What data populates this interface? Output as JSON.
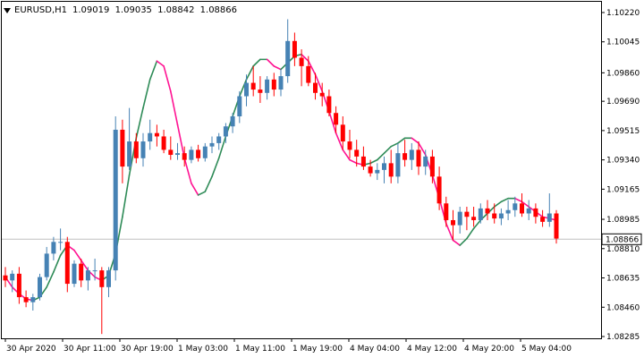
{
  "header": {
    "symbol_timeframe": "EURUSD,H1",
    "open": "1.09019",
    "high": "1.09035",
    "low": "1.08842",
    "close": "1.08866"
  },
  "current_price": "1.08866",
  "colors": {
    "bull_candle": "#4682b4",
    "bear_candle": "#ff0000",
    "ma_up": "#2e8b57",
    "ma_down": "#ff1493",
    "price_line": "#c0c0c0"
  },
  "chart_data": {
    "type": "candlestick",
    "price_axis_labels": [
      "1.10220",
      "1.10045",
      "1.09860",
      "1.09690",
      "1.09515",
      "1.09340",
      "1.09165",
      "1.08985",
      "1.08810",
      "1.08635",
      "1.08460",
      "1.08285"
    ],
    "time_axis_labels": [
      "30 Apr 2020",
      "30 Apr 11:00",
      "30 Apr 19:00",
      "1 May 03:00",
      "1 May 11:00",
      "1 May 19:00",
      "4 May 04:00",
      "4 May 12:00",
      "4 May 20:00",
      "5 May 04:00"
    ],
    "ylim": [
      1.08285,
      1.1022
    ],
    "candles": [
      [
        1.0865,
        1.087,
        1.0858,
        1.0862
      ],
      [
        1.0862,
        1.0868,
        1.0855,
        1.0866
      ],
      [
        1.0866,
        1.087,
        1.0848,
        1.0852
      ],
      [
        1.0852,
        1.0856,
        1.0846,
        1.0849
      ],
      [
        1.0849,
        1.0854,
        1.0844,
        1.0852
      ],
      [
        1.0852,
        1.0866,
        1.085,
        1.0864
      ],
      [
        1.0864,
        1.0882,
        1.0862,
        1.0878
      ],
      [
        1.0878,
        1.0888,
        1.0874,
        1.0885
      ],
      [
        1.0885,
        1.0893,
        1.088,
        1.0885
      ],
      [
        1.0885,
        1.0888,
        1.0855,
        1.086
      ],
      [
        1.086,
        1.0874,
        1.0858,
        1.0872
      ],
      [
        1.0872,
        1.0875,
        1.0858,
        1.0862
      ],
      [
        1.0862,
        1.087,
        1.0856,
        1.0868
      ],
      [
        1.0868,
        1.0875,
        1.0862,
        1.0868
      ],
      [
        1.0868,
        1.087,
        1.083,
        1.0858
      ],
      [
        1.0858,
        1.087,
        1.0852,
        1.0868
      ],
      [
        1.0868,
        1.096,
        1.0862,
        1.0952
      ],
      [
        1.0952,
        1.0958,
        1.092,
        1.093
      ],
      [
        1.093,
        1.0965,
        1.0928,
        1.0945
      ],
      [
        1.0945,
        1.095,
        1.0932,
        1.0935
      ],
      [
        1.0935,
        1.095,
        1.093,
        1.0945
      ],
      [
        1.0945,
        1.0958,
        1.094,
        1.095
      ],
      [
        1.095,
        1.0955,
        1.0942,
        1.0948
      ],
      [
        1.0948,
        1.0952,
        1.0938,
        1.094
      ],
      [
        1.094,
        1.0948,
        1.0934,
        1.0937
      ],
      [
        1.0937,
        1.0944,
        1.0934,
        1.0938
      ],
      [
        1.0938,
        1.0942,
        1.093,
        1.0934
      ],
      [
        1.0934,
        1.0942,
        1.0932,
        1.094
      ],
      [
        1.094,
        1.0943,
        1.0933,
        1.0935
      ],
      [
        1.0935,
        1.0944,
        1.0933,
        1.0942
      ],
      [
        1.0942,
        1.0948,
        1.0938,
        1.0944
      ],
      [
        1.0944,
        1.095,
        1.094,
        1.0948
      ],
      [
        1.0948,
        1.0956,
        1.0944,
        1.0954
      ],
      [
        1.0954,
        1.0962,
        1.095,
        1.096
      ],
      [
        1.096,
        1.0975,
        1.0956,
        1.0972
      ],
      [
        1.0972,
        1.0985,
        1.0966,
        1.098
      ],
      [
        1.098,
        1.099,
        1.0972,
        1.0976
      ],
      [
        1.0976,
        1.0984,
        1.0968,
        1.0974
      ],
      [
        1.0974,
        1.0984,
        1.097,
        1.0982
      ],
      [
        1.0982,
        1.0986,
        1.0972,
        1.0976
      ],
      [
        1.0976,
        1.0988,
        1.0972,
        1.0984
      ],
      [
        1.0984,
        1.1018,
        1.098,
        1.1005
      ],
      [
        1.1005,
        1.101,
        1.099,
        1.0995
      ],
      [
        1.0995,
        1.1,
        1.0978,
        1.099
      ],
      [
        1.099,
        1.0996,
        1.0978,
        1.098
      ],
      [
        1.098,
        1.0986,
        1.097,
        1.0974
      ],
      [
        1.0974,
        1.098,
        1.0966,
        1.0972
      ],
      [
        1.0972,
        1.0976,
        1.096,
        1.0962
      ],
      [
        1.0962,
        1.0966,
        1.095,
        1.0955
      ],
      [
        1.0955,
        1.096,
        1.094,
        1.0945
      ],
      [
        1.0945,
        1.0952,
        1.0935,
        1.094
      ],
      [
        1.094,
        1.0946,
        1.093,
        1.0936
      ],
      [
        1.0936,
        1.0942,
        1.0928,
        1.093
      ],
      [
        1.093,
        1.0934,
        1.0924,
        1.0926
      ],
      [
        1.0926,
        1.0932,
        1.0922,
        1.0928
      ],
      [
        1.0928,
        1.0936,
        1.092,
        1.0932
      ],
      [
        1.0932,
        1.094,
        1.092,
        1.0924
      ],
      [
        1.0924,
        1.0944,
        1.092,
        1.0938
      ],
      [
        1.0938,
        1.0946,
        1.093,
        1.0934
      ],
      [
        1.0934,
        1.0944,
        1.0928,
        1.094
      ],
      [
        1.094,
        1.0945,
        1.0925,
        1.093
      ],
      [
        1.093,
        1.094,
        1.0925,
        1.0936
      ],
      [
        1.0936,
        1.094,
        1.092,
        1.0924
      ],
      [
        1.0924,
        1.093,
        1.0904,
        1.0908
      ],
      [
        1.0908,
        1.0912,
        1.0894,
        1.0898
      ],
      [
        1.0898,
        1.0904,
        1.0886,
        1.0895
      ],
      [
        1.0895,
        1.0906,
        1.089,
        1.0903
      ],
      [
        1.0903,
        1.0906,
        1.0892,
        1.09
      ],
      [
        1.09,
        1.0906,
        1.0894,
        1.0898
      ],
      [
        1.0898,
        1.0908,
        1.0896,
        1.0905
      ],
      [
        1.0905,
        1.091,
        1.0898,
        1.0902
      ],
      [
        1.0902,
        1.0908,
        1.0896,
        1.0899
      ],
      [
        1.0899,
        1.0905,
        1.0895,
        1.0902
      ],
      [
        1.0902,
        1.091,
        1.0898,
        1.0904
      ],
      [
        1.0904,
        1.0912,
        1.09,
        1.0908
      ],
      [
        1.0908,
        1.0914,
        1.09,
        1.0902
      ],
      [
        1.0902,
        1.091,
        1.0898,
        1.0905
      ],
      [
        1.0905,
        1.0908,
        1.0896,
        1.09
      ],
      [
        1.09,
        1.0904,
        1.0894,
        1.0897
      ],
      [
        1.0897,
        1.0914,
        1.0894,
        1.0902
      ],
      [
        1.0902,
        1.0904,
        1.0884,
        1.0887
      ]
    ],
    "moving_average": [
      1.0864,
      1.0858,
      1.0854,
      1.0851,
      1.085,
      1.0852,
      1.0858,
      1.0867,
      1.0877,
      1.0883,
      1.088,
      1.0874,
      1.0868,
      1.0864,
      1.0862,
      1.0865,
      1.0878,
      1.09,
      1.0925,
      1.0947,
      1.0965,
      1.0982,
      1.0993,
      1.099,
      1.0975,
      1.0955,
      1.0935,
      1.092,
      1.0913,
      1.0915,
      1.0924,
      1.0935,
      1.0948,
      1.096,
      1.0972,
      1.0982,
      1.099,
      1.0994,
      1.0994,
      1.099,
      1.0988,
      1.0992,
      1.0996,
      1.0997,
      1.0993,
      1.0985,
      1.0975,
      1.0963,
      1.095,
      1.094,
      1.0934,
      1.0932,
      1.0931,
      1.0932,
      1.0934,
      1.0938,
      1.0942,
      1.0944,
      1.0947,
      1.0947,
      1.0944,
      1.0937,
      1.0925,
      1.0911,
      1.0896,
      1.0886,
      1.0883,
      1.0887,
      1.0893,
      1.0898,
      1.0902,
      1.0906,
      1.0909,
      1.0911,
      1.0911,
      1.0909,
      1.0906,
      1.0903,
      1.09,
      1.0899,
      1.0898
    ]
  }
}
